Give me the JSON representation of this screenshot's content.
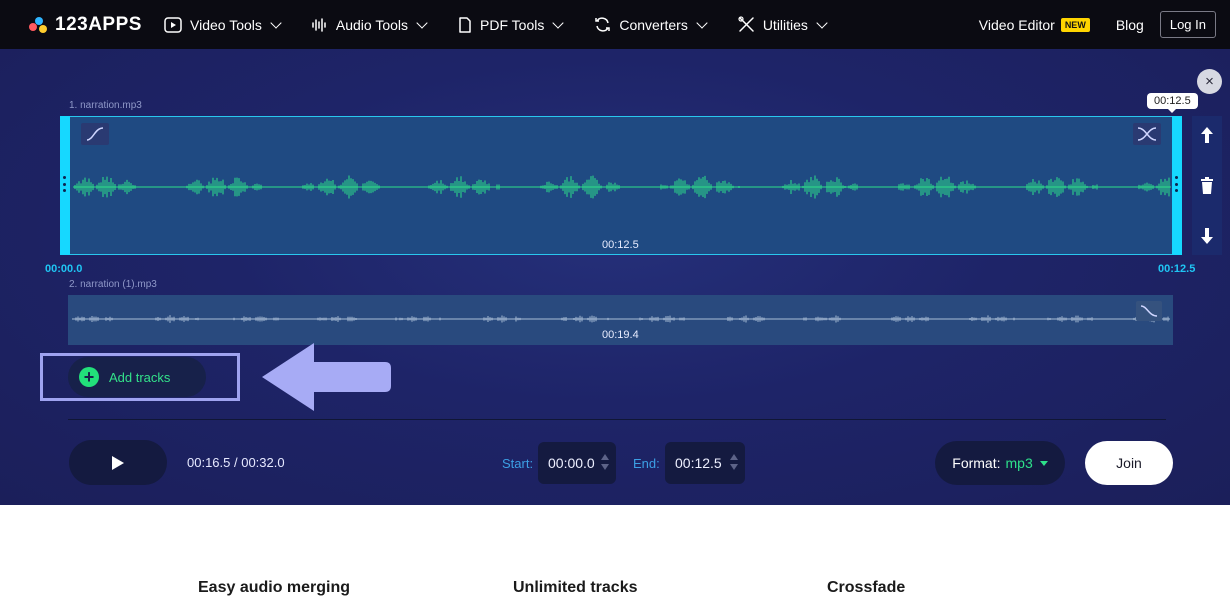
{
  "logo": {
    "text": "123APPS"
  },
  "nav": {
    "items": [
      {
        "label": "Video Tools",
        "icon": "play-square-icon"
      },
      {
        "label": "Audio Tools",
        "icon": "audio-wave-icon"
      },
      {
        "label": "PDF Tools",
        "icon": "document-icon"
      },
      {
        "label": "Converters",
        "icon": "convert-icon"
      },
      {
        "label": "Utilities",
        "icon": "tools-icon"
      }
    ],
    "video_editor": "Video Editor",
    "new_badge": "NEW",
    "blog": "Blog",
    "login": "Log In"
  },
  "editor": {
    "close_icon": "×",
    "tracks": [
      {
        "name": "1. narration.mp3",
        "duration": "00:12.5",
        "selected": true
      },
      {
        "name": "2. narration (1).mp3",
        "duration": "00:19.4",
        "selected": false
      }
    ],
    "tooltip_time": "00:12.5",
    "start_mark": "00:00.0",
    "end_mark": "00:12.5",
    "add_tracks": "Add tracks",
    "playback": {
      "position": "00:16.5",
      "separator": " / ",
      "total": "00:32.0"
    },
    "start_label": "Start:",
    "start_value": "00:00.0",
    "end_label": "End:",
    "end_value": "00:12.5",
    "format_label": "Format:",
    "format_value": "mp3",
    "join": "Join"
  },
  "features": [
    "Easy audio merging",
    "Unlimited tracks",
    "Crossfade"
  ],
  "colors": {
    "waveform_selected": "#2ee08a",
    "waveform_unselected": "#a9bdd6",
    "accent_cyan": "#16d8ff",
    "panel_bg": "#1e2468",
    "add_green": "#22e07a",
    "highlight_outline": "#9fa3f0"
  }
}
